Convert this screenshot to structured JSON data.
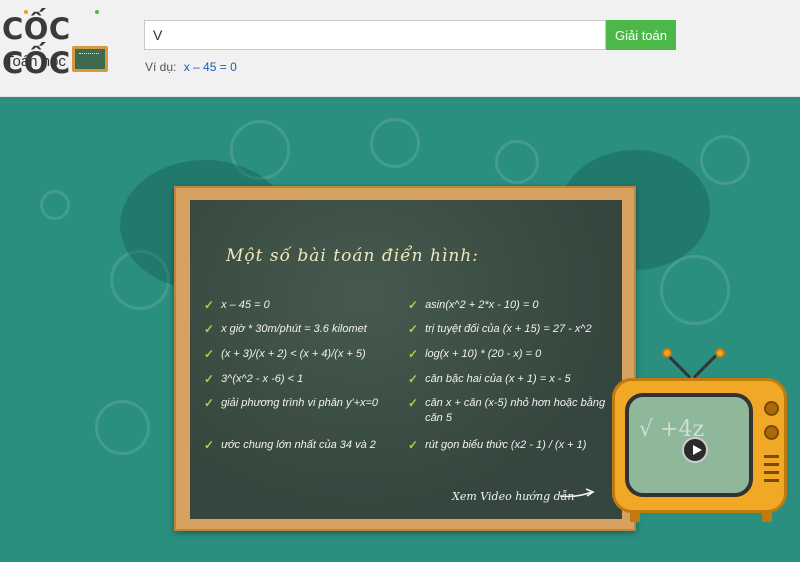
{
  "header": {
    "logo_text": "CỐC CỐC",
    "logo_sub": "Toán học",
    "search": {
      "value": "V",
      "placeholder": ""
    },
    "search_button": "Giải toán",
    "example_label": "Ví dụ:",
    "example_link": "x – 45 = 0"
  },
  "board": {
    "title": "Một số bài toán điển hình:",
    "problems_left": [
      "x – 45 = 0",
      "x giờ * 30m/phút = 3.6 kilomet",
      "(x + 3)/(x + 2) < (x + 4)/(x + 5)",
      "3^(x^2 - x -6) < 1",
      "giải phương trình vi phân y'+x=0",
      "ước chung lớn nhất của 34 và 2"
    ],
    "problems_right": [
      "asin(x^2 + 2*x - 10) = 0",
      "trị tuyệt đối của (x + 15) = 27 - x^2",
      "log(x + 10) * (20 - x) = 0",
      "căn bậc hai của (x + 1) = x - 5",
      "căn x + căn (x-5) nhỏ hơn hoặc bằng căn 5",
      "rút gọn biểu thức (x2 - 1) / (x + 1)"
    ],
    "video_link": "Xem Video hướng dẫn"
  },
  "colors": {
    "background": "#2b8f80",
    "button_green": "#4cb848",
    "board_frame": "#d7a25f",
    "board_surface": "#3b4c43",
    "check_green": "#9ad64a",
    "tv_orange": "#f0a826"
  }
}
